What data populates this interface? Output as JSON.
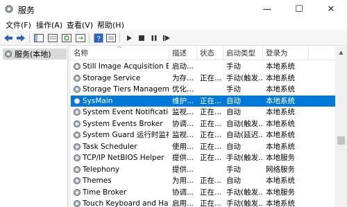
{
  "window": {
    "title": "服务",
    "min_glyph": "—",
    "max_glyph": "☐",
    "close_glyph": "✕"
  },
  "menu": [
    "文件(F)",
    "操作(A)",
    "查看(V)",
    "帮助(H)"
  ],
  "toolbar": [
    "back-icon",
    "forward-icon",
    "show-tree-icon",
    "console-icon",
    "refresh-icon",
    "export-icon",
    "help-icon",
    "properties-icon",
    "play-icon",
    "stop-icon",
    "pause-icon",
    "restart-icon"
  ],
  "tree": {
    "root_label": "服务(本地)"
  },
  "table": {
    "columns": [
      "名称",
      "描述",
      "状态",
      "启动类型",
      "登录为"
    ],
    "sort_indicator": "^",
    "rows": [
      {
        "name": "Still Image Acquisition Ev...",
        "desc": "启动...",
        "status": "",
        "startup": "手动",
        "logon": "本地系统",
        "selected": false
      },
      {
        "name": "Storage Service",
        "desc": "为存...",
        "status": "正在...",
        "startup": "手动(触发...",
        "logon": "本地系统",
        "selected": false
      },
      {
        "name": "Storage Tiers Managem...",
        "desc": "优化...",
        "status": "",
        "startup": "手动",
        "logon": "本地系统",
        "selected": false
      },
      {
        "name": "SysMain",
        "desc": "维护...",
        "status": "正在...",
        "startup": "自动",
        "logon": "本地系统",
        "selected": true
      },
      {
        "name": "System Event Notification...",
        "desc": "监视...",
        "status": "正在...",
        "startup": "自动",
        "logon": "本地系统",
        "selected": false
      },
      {
        "name": "System Events Broker",
        "desc": "协调...",
        "status": "正在...",
        "startup": "自动(触发...",
        "logon": "本地系统",
        "selected": false
      },
      {
        "name": "System Guard 运行时监视...",
        "desc": "监视...",
        "status": "正在...",
        "startup": "自动(延迟...",
        "logon": "本地系统",
        "selected": false
      },
      {
        "name": "Task Scheduler",
        "desc": "使用...",
        "status": "正在...",
        "startup": "自动",
        "logon": "本地系统",
        "selected": false
      },
      {
        "name": "TCP/IP NetBIOS Helper",
        "desc": "提供...",
        "status": "正在...",
        "startup": "手动(触发...",
        "logon": "本地服务",
        "selected": false
      },
      {
        "name": "Telephony",
        "desc": "提供...",
        "status": "",
        "startup": "手动",
        "logon": "网络服务",
        "selected": false
      },
      {
        "name": "Themes",
        "desc": "为用...",
        "status": "正在...",
        "startup": "自动",
        "logon": "本地系统",
        "selected": false
      },
      {
        "name": "Time Broker",
        "desc": "协调...",
        "status": "正在...",
        "startup": "手动(触发...",
        "logon": "本地服务",
        "selected": false
      },
      {
        "name": "Touch Keyboard and Ha...",
        "desc": "启用...",
        "status": "正在...",
        "startup": "手动(触发...",
        "logon": "本地系统",
        "selected": false
      }
    ]
  },
  "colors": {
    "selection": "#0078d7",
    "toolbar_bg": "#f5f5f5"
  }
}
